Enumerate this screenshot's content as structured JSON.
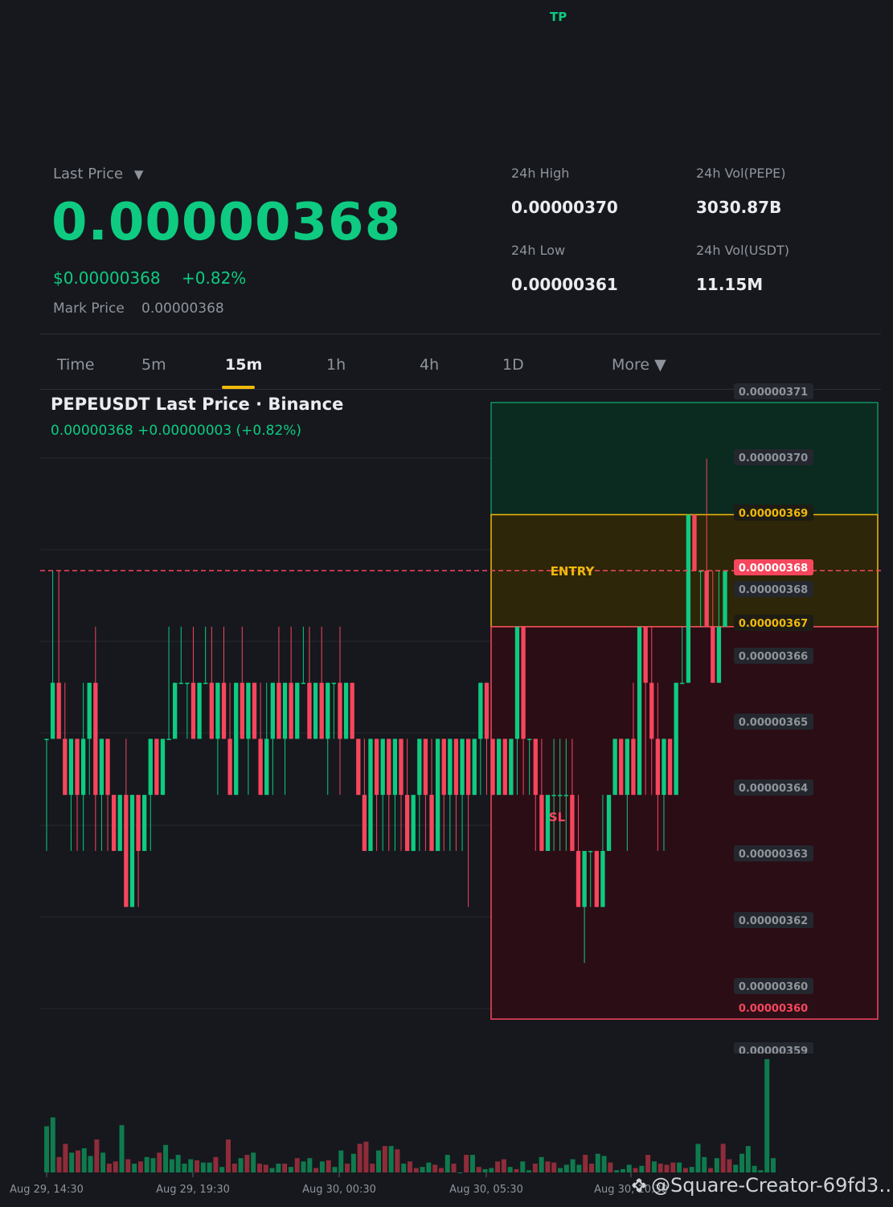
{
  "header": {
    "tp_label": "TP",
    "last_price_label": "Last Price",
    "last_price_caret": "▼",
    "last_price": "0.00000368",
    "usd_price": "$0.00000368",
    "change_pct": "+0.82%",
    "mark_price_label": "Mark Price",
    "mark_price": "0.00000368"
  },
  "stats": {
    "high_label": "24h High",
    "high_value": "0.00000370",
    "low_label": "24h Low",
    "low_value": "0.00000361",
    "vol_base_label": "24h Vol(PEPE)",
    "vol_base_value": "3030.87B",
    "vol_quote_label": "24h Vol(USDT)",
    "vol_quote_value": "11.15M"
  },
  "tabs": [
    {
      "label": "Time"
    },
    {
      "label": "5m"
    },
    {
      "label": "15m"
    },
    {
      "label": "1h"
    },
    {
      "label": "4h"
    },
    {
      "label": "1D"
    },
    {
      "label": "More ▼"
    }
  ],
  "active_tab": "15m",
  "chart": {
    "title": "PEPEUSDT Last Price · Binance",
    "subtitle": "0.00000368  +0.00000003 (+0.82%)"
  },
  "colors": {
    "up": "#0ecb81",
    "down": "#f6465d",
    "entry": "#f0b90b",
    "background": "#16181d"
  },
  "icons": {
    "dropdown": "caret-down-icon",
    "watermark_logo": "binance-logo-icon"
  },
  "watermark": "@Square-Creator-69fd3…",
  "chart_data": {
    "type": "candlestick",
    "interval": "15m",
    "symbol": "PEPEUSDT",
    "price_axis_labels": [
      "0.00000371",
      "0.00000370",
      "0.00000369",
      "0.00000368",
      "0.00000368",
      "0.00000367",
      "0.00000366",
      "0.00000365",
      "0.00000364",
      "0.00000363",
      "0.00000362",
      "0.00000360",
      "0.00000360",
      "0.00000359"
    ],
    "ylim": [
      3.594e-06,
      3.712e-06
    ],
    "last_price": 3.68e-06,
    "time_labels": [
      "Aug 29, 14:30",
      "Aug 29, 19:30",
      "Aug 30, 00:30",
      "Aug 30, 05:30",
      "Aug 30, 10:30"
    ],
    "position": {
      "entry_label": "ENTRY",
      "stop_label": "SL",
      "take_profit": 3.71e-06,
      "entry_high": 3.69e-06,
      "entry_low": 3.67e-06,
      "stop": 3.6e-06,
      "tp_tag": "0.00000369",
      "entry_tag": "0.00000367",
      "stop_tag": "0.00000360",
      "last_tag": "0.00000368"
    },
    "candles": [
      [
        365,
        365,
        363,
        365
      ],
      [
        365,
        368,
        365,
        366
      ],
      [
        366,
        368,
        365,
        365
      ],
      [
        365,
        366,
        364,
        364
      ],
      [
        364,
        365,
        363,
        365
      ],
      [
        365,
        365,
        363,
        364
      ],
      [
        364,
        366,
        363,
        365
      ],
      [
        365,
        366,
        364,
        366
      ],
      [
        366,
        367,
        363,
        364
      ],
      [
        364,
        365,
        363,
        365
      ],
      [
        365,
        365,
        363,
        364
      ],
      [
        364,
        364,
        363,
        363
      ],
      [
        363,
        364,
        363,
        364
      ],
      [
        364,
        365,
        362,
        362
      ],
      [
        362,
        364,
        362,
        364
      ],
      [
        364,
        364,
        362,
        363
      ],
      [
        363,
        364,
        363,
        364
      ],
      [
        364,
        365,
        363,
        365
      ],
      [
        365,
        365,
        364,
        364
      ],
      [
        364,
        365,
        364,
        365
      ],
      [
        365,
        367,
        365,
        365
      ],
      [
        365,
        366,
        365,
        366
      ],
      [
        366,
        367,
        366,
        366
      ],
      [
        366,
        366,
        365,
        366
      ],
      [
        366,
        367,
        366,
        365
      ],
      [
        365,
        366,
        365,
        366
      ],
      [
        366,
        367,
        366,
        366
      ],
      [
        366,
        367,
        365,
        365
      ],
      [
        365,
        366,
        364,
        366
      ],
      [
        366,
        367,
        365,
        365
      ],
      [
        365,
        366,
        364,
        364
      ],
      [
        364,
        366,
        364,
        366
      ],
      [
        366,
        367,
        365,
        365
      ],
      [
        365,
        366,
        364,
        366
      ],
      [
        366,
        366,
        365,
        365
      ],
      [
        365,
        366,
        364,
        364
      ],
      [
        364,
        366,
        364,
        365
      ],
      [
        365,
        365,
        364,
        366
      ],
      [
        366,
        367,
        365,
        365
      ],
      [
        365,
        366,
        364,
        366
      ],
      [
        366,
        367,
        365,
        365
      ],
      [
        365,
        366,
        365,
        366
      ],
      [
        366,
        367,
        366,
        366
      ],
      [
        366,
        367,
        366,
        365
      ],
      [
        365,
        366,
        365,
        366
      ],
      [
        366,
        367,
        365,
        365
      ],
      [
        365,
        366,
        364,
        366
      ],
      [
        366,
        366,
        365,
        366
      ],
      [
        366,
        367,
        364,
        365
      ],
      [
        365,
        366,
        365,
        366
      ],
      [
        366,
        366,
        365,
        365
      ],
      [
        365,
        365,
        364,
        364
      ],
      [
        364,
        365,
        363,
        363
      ],
      [
        363,
        364,
        363,
        365
      ],
      [
        365,
        365,
        363,
        364
      ],
      [
        364,
        365,
        363,
        365
      ],
      [
        365,
        365,
        363,
        364
      ],
      [
        364,
        365,
        363,
        365
      ],
      [
        365,
        365,
        363,
        364
      ],
      [
        364,
        365,
        363,
        363
      ],
      [
        363,
        364,
        363,
        364
      ],
      [
        364,
        365,
        363,
        365
      ],
      [
        365,
        365,
        363,
        364
      ],
      [
        364,
        365,
        363,
        363
      ],
      [
        363,
        364,
        363,
        365
      ],
      [
        365,
        365,
        363,
        364
      ],
      [
        364,
        365,
        363,
        365
      ],
      [
        365,
        365,
        363,
        364
      ],
      [
        364,
        364,
        363,
        365
      ],
      [
        365,
        365,
        362,
        364
      ],
      [
        364,
        365,
        364,
        365
      ],
      [
        365,
        366,
        364,
        366
      ],
      [
        366,
        366,
        364,
        365
      ],
      [
        365,
        365,
        364,
        364
      ],
      [
        364,
        365,
        364,
        365
      ],
      [
        365,
        365,
        364,
        364
      ],
      [
        364,
        365,
        364,
        365
      ],
      [
        365,
        366,
        364,
        367
      ],
      [
        367,
        367,
        364,
        365
      ],
      [
        365,
        365,
        364,
        365
      ],
      [
        365,
        365,
        363,
        364
      ],
      [
        364,
        365,
        363,
        363
      ],
      [
        363,
        364,
        363,
        364
      ],
      [
        364,
        365,
        363,
        364
      ],
      [
        364,
        365,
        363,
        364
      ],
      [
        364,
        365,
        363,
        364
      ],
      [
        364,
        365,
        363,
        363
      ],
      [
        363,
        364,
        362,
        362
      ],
      [
        362,
        363,
        361,
        363
      ],
      [
        363,
        363,
        362,
        363
      ],
      [
        363,
        363,
        362,
        362
      ],
      [
        362,
        364,
        362,
        363
      ],
      [
        363,
        364,
        363,
        364
      ],
      [
        364,
        365,
        364,
        365
      ],
      [
        365,
        365,
        364,
        364
      ],
      [
        364,
        365,
        363,
        365
      ],
      [
        365,
        366,
        364,
        364
      ],
      [
        364,
        367,
        364,
        367
      ],
      [
        367,
        367,
        364,
        366
      ],
      [
        366,
        367,
        364,
        365
      ],
      [
        365,
        366,
        363,
        364
      ],
      [
        364,
        365,
        363,
        365
      ],
      [
        365,
        365,
        364,
        364
      ],
      [
        364,
        366,
        364,
        366
      ],
      [
        366,
        367,
        366,
        366
      ],
      [
        366,
        369,
        366,
        369
      ],
      [
        369,
        369,
        368,
        368
      ],
      [
        368,
        368,
        367,
        368
      ],
      [
        368,
        370,
        367,
        367
      ],
      [
        367,
        368,
        366,
        366
      ],
      [
        366,
        368,
        366,
        367
      ],
      [
        367,
        368,
        367,
        368
      ]
    ],
    "volume": [
      42,
      50,
      14,
      26,
      18,
      20,
      22,
      15,
      30,
      18,
      8,
      10,
      43,
      12,
      8,
      10,
      14,
      13,
      18,
      25,
      12,
      16,
      8,
      12,
      11,
      9,
      9,
      14,
      5,
      30,
      8,
      13,
      16,
      18,
      8,
      7,
      4,
      8,
      8,
      5,
      13,
      10,
      13,
      4,
      10,
      11,
      5,
      20,
      8,
      17,
      26,
      28,
      8,
      20,
      24,
      24,
      21,
      8,
      10,
      4,
      5,
      9,
      7,
      4,
      16,
      8,
      0,
      16,
      16,
      5,
      3,
      4,
      10,
      12,
      5,
      3,
      10,
      2,
      8,
      14,
      10,
      9,
      4,
      7,
      12,
      7,
      16,
      8,
      17,
      15,
      9,
      2,
      3,
      7,
      4,
      6,
      16,
      10,
      8,
      7,
      9,
      9,
      4,
      5,
      26,
      14,
      4,
      13,
      26,
      12,
      7,
      17,
      24,
      6,
      2,
      103,
      13
    ]
  }
}
